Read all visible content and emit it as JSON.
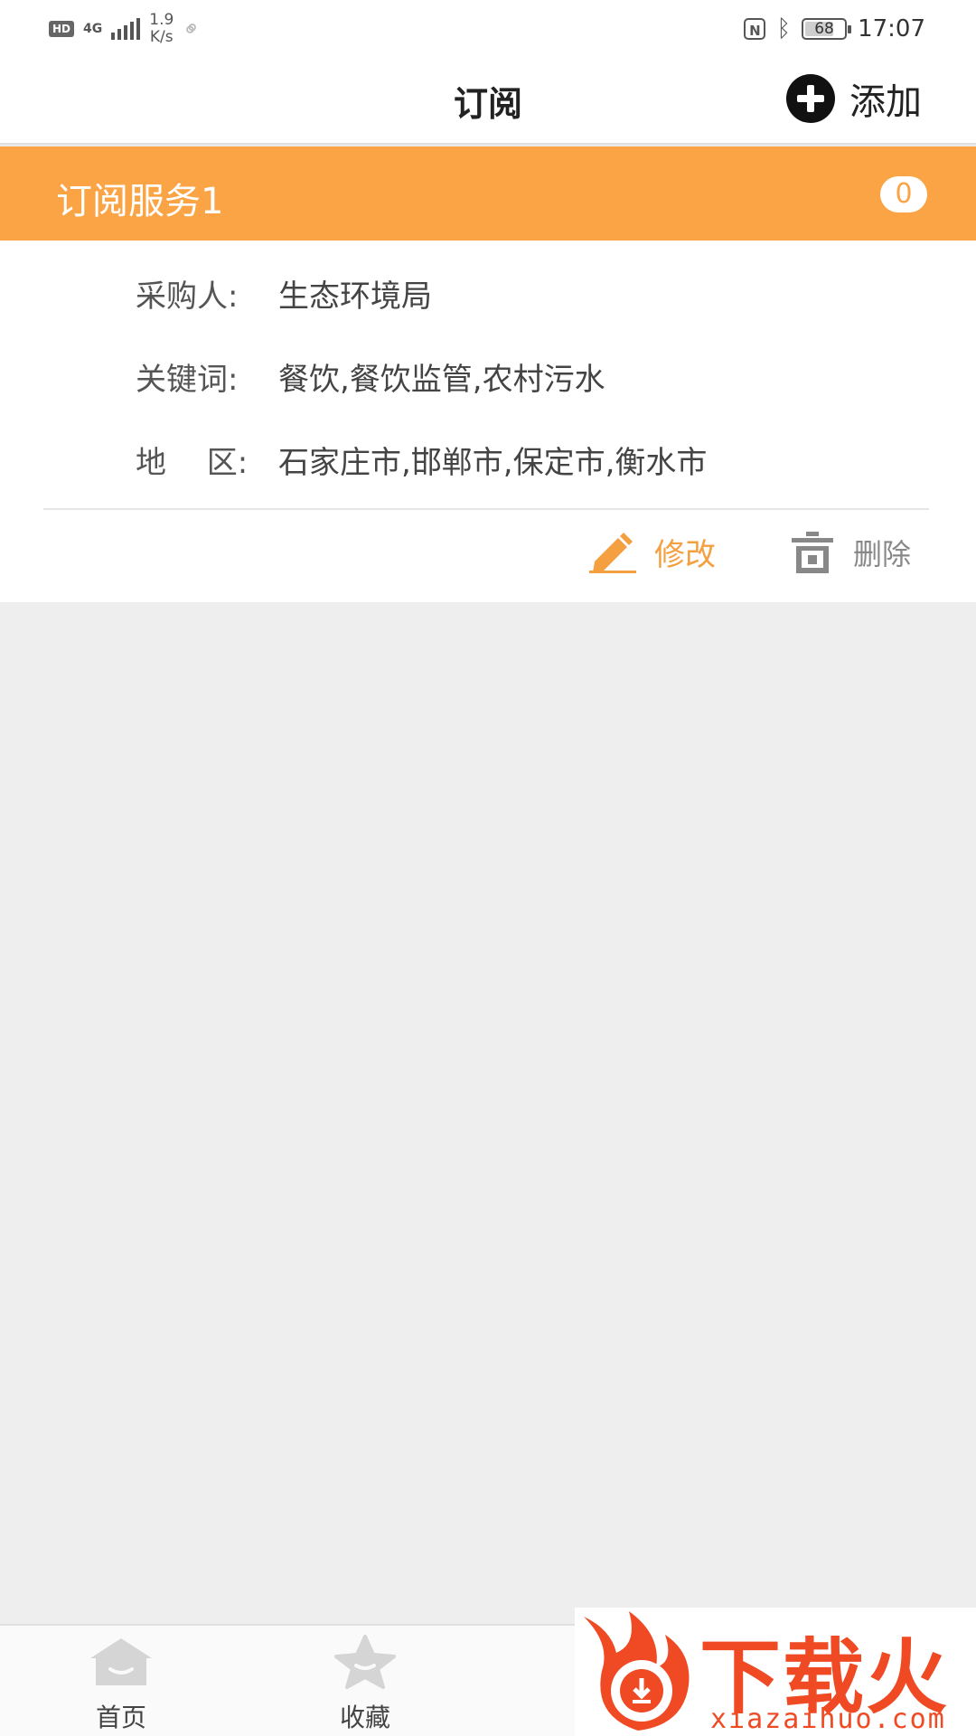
{
  "status_bar": {
    "hd": "HD",
    "network": "4G",
    "speed_value": "1.9",
    "speed_unit": "K/s",
    "battery": "68",
    "time": "17:07"
  },
  "header": {
    "title": "订阅",
    "add_label": "添加"
  },
  "subscription": {
    "title": "订阅服务1",
    "count": "0",
    "fields": [
      {
        "label": "采购人:",
        "value": "生态环境局"
      },
      {
        "label": "关键词:",
        "value": "餐饮,餐饮监管,农村污水"
      },
      {
        "label": "地　 区:",
        "value": "石家庄市,邯郸市,保定市,衡水市"
      }
    ],
    "edit_label": "修改",
    "delete_label": "删除"
  },
  "colors": {
    "accent": "#fba446",
    "edit": "#f4a040",
    "background": "#eeeeee",
    "watermark": "#ef4a24"
  },
  "tabbar": {
    "items": [
      {
        "label": "首页",
        "icon": "home-icon"
      },
      {
        "label": "收藏",
        "icon": "star-icon"
      }
    ]
  },
  "watermark": {
    "brand": "下载火",
    "url": "xiazaihuo.com"
  }
}
